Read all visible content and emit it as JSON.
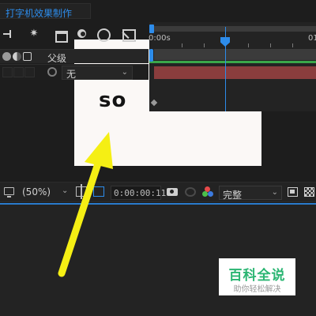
{
  "composition": {
    "tab_title": "打字机效果制作",
    "tab_title_color": "#2d8ceb"
  },
  "viewer": {
    "canvas_text": "so",
    "canvas_background": "#fbf8f6"
  },
  "viewer_toolbar": {
    "zoom": "(50%)",
    "current_time": "0:00:00:11",
    "resolution": "完整"
  },
  "timeline": {
    "ruler_start_label": "0:00s",
    "ruler_end_label": "01",
    "parent_column_header": "父级",
    "layers": [
      {
        "parent_value": "无"
      }
    ]
  },
  "watermark": {
    "title": "百科全说",
    "subtitle": "助你轻松解决",
    "color": "#2ab572"
  },
  "annotation": {
    "arrow_color": "#f5ef14"
  },
  "colors": {
    "accent": "#2d8ceb",
    "panel_background": "#232323"
  }
}
